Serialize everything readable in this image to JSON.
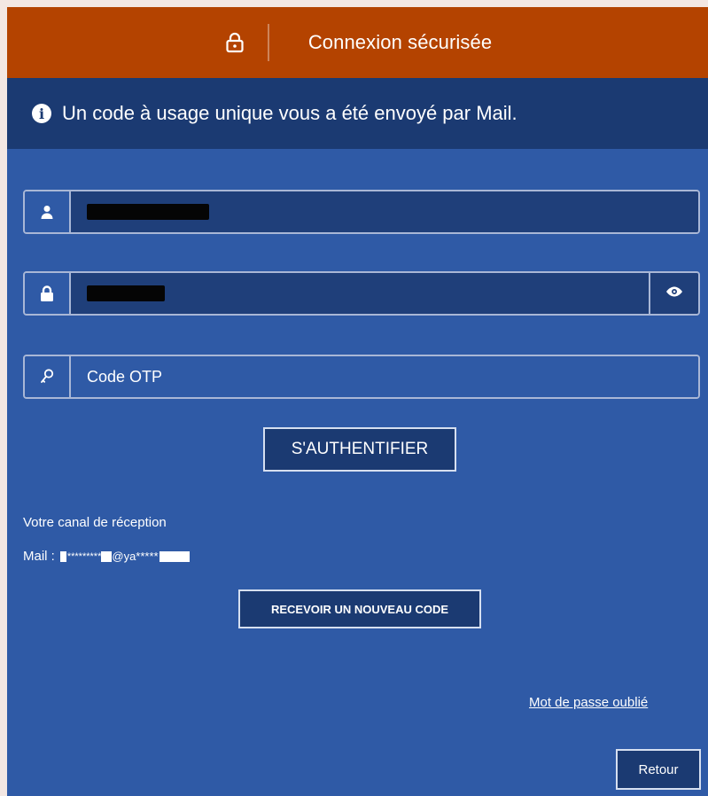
{
  "header": {
    "title": "Connexion sécurisée",
    "lock_icon": "lock-icon"
  },
  "info": {
    "message": "Un code à usage unique vous a été envoyé par Mail.",
    "icon": "info-circle-icon"
  },
  "form": {
    "username": {
      "icon": "user-icon",
      "value": ""
    },
    "password": {
      "icon": "lock-icon",
      "value": "",
      "toggle_icon": "eye-icon"
    },
    "otp": {
      "icon": "key-icon",
      "placeholder": "Code OTP"
    }
  },
  "buttons": {
    "authenticate": "S'AUTHENTIFIER",
    "resend": "RECEVOIR UN NOUVEAU CODE",
    "back": "Retour"
  },
  "reception": {
    "label": "Votre canal de réception",
    "mail_prefix": "Mail :",
    "mask1": "*********",
    "mask2": "@ya*****"
  },
  "links": {
    "forgot_password": "Mot de passe oublié"
  },
  "colors": {
    "header_bg": "#b44300",
    "info_bg": "#1b3a72",
    "panel_bg": "#2f5aa6",
    "field_bg": "#1f3f7a"
  }
}
